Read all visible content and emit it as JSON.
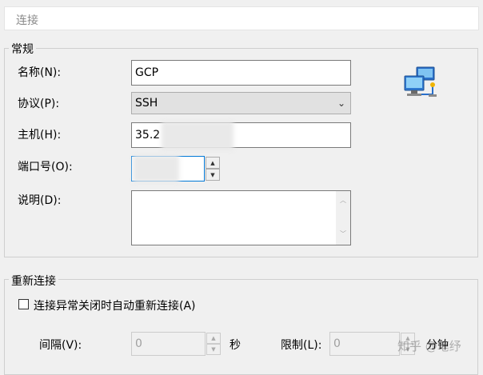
{
  "header": {
    "title": "连接"
  },
  "general": {
    "legend": "常规",
    "name_label": "名称(N):",
    "name_value": "GCP",
    "protocol_label": "协议(P):",
    "protocol_value": "SSH",
    "host_label": "主机(H):",
    "host_value": "35.2",
    "port_label": "端口号(O):",
    "desc_label": "说明(D):",
    "icon": "network-computers-icon"
  },
  "reconnect": {
    "legend": "重新连接",
    "checkbox_label": "连接异常关闭时自动重新连接(A)",
    "interval_label": "间隔(V):",
    "interval_value": "0",
    "interval_unit": "秒",
    "limit_label": "限制(L):",
    "limit_value": "0",
    "limit_unit": "分钟"
  },
  "watermark": "知乎 @笔纾"
}
